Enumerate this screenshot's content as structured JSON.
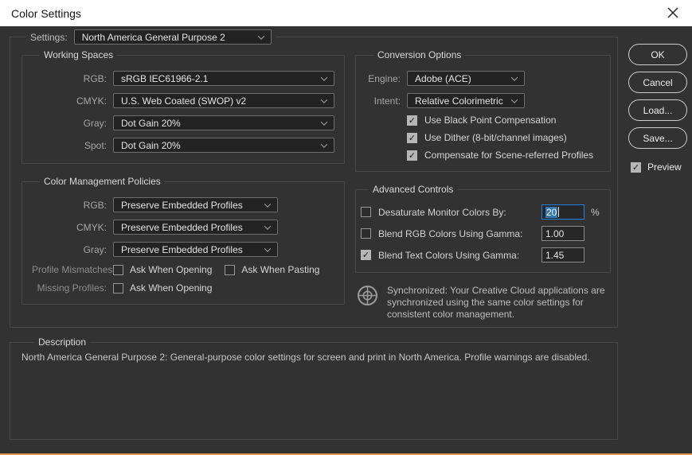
{
  "window": {
    "title": "Color Settings"
  },
  "settings": {
    "label": "Settings:",
    "value": "North America General Purpose 2"
  },
  "working_spaces": {
    "title": "Working Spaces",
    "rows": [
      {
        "label": "RGB:",
        "value": "sRGB IEC61966-2.1"
      },
      {
        "label": "CMYK:",
        "value": "U.S. Web Coated (SWOP) v2"
      },
      {
        "label": "Gray:",
        "value": "Dot Gain 20%"
      },
      {
        "label": "Spot:",
        "value": "Dot Gain 20%"
      }
    ]
  },
  "color_management_policies": {
    "title": "Color Management Policies",
    "rows": [
      {
        "label": "RGB:",
        "value": "Preserve Embedded Profiles"
      },
      {
        "label": "CMYK:",
        "value": "Preserve Embedded Profiles"
      },
      {
        "label": "Gray:",
        "value": "Preserve Embedded Profiles"
      }
    ],
    "profile_mismatches": {
      "label": "Profile Mismatches:",
      "options": [
        {
          "label": "Ask When Opening",
          "checked": false
        },
        {
          "label": "Ask When Pasting",
          "checked": false
        }
      ]
    },
    "missing_profiles": {
      "label": "Missing Profiles:",
      "options": [
        {
          "label": "Ask When Opening",
          "checked": false
        }
      ]
    }
  },
  "conversion_options": {
    "title": "Conversion Options",
    "engine": {
      "label": "Engine:",
      "value": "Adobe (ACE)"
    },
    "intent": {
      "label": "Intent:",
      "value": "Relative Colorimetric"
    },
    "checkboxes": [
      {
        "label": "Use Black Point Compensation",
        "checked": true
      },
      {
        "label": "Use Dither (8-bit/channel images)",
        "checked": true
      },
      {
        "label": "Compensate for Scene-referred Profiles",
        "checked": true
      }
    ]
  },
  "advanced_controls": {
    "title": "Advanced Controls",
    "rows": [
      {
        "label": "Desaturate Monitor Colors By:",
        "value": "20",
        "suffix": "%",
        "checked": false,
        "focused": true
      },
      {
        "label": "Blend RGB Colors Using Gamma:",
        "value": "1.00",
        "suffix": "",
        "checked": false
      },
      {
        "label": "Blend Text Colors Using Gamma:",
        "value": "1.45",
        "suffix": "",
        "checked": true
      }
    ]
  },
  "sync": {
    "icon": "creative-cloud-sync-icon",
    "text": "Synchronized: Your Creative Cloud applications are synchronized using the same color settings for consistent color management."
  },
  "buttons": {
    "ok": "OK",
    "cancel": "Cancel",
    "load": "Load...",
    "save": "Save..."
  },
  "preview": {
    "label": "Preview",
    "checked": true
  },
  "description": {
    "title": "Description",
    "text": "North America General Purpose 2:  General-purpose color settings for screen and print in North America. Profile warnings are disabled."
  },
  "colors": {
    "dialog_bg": "#323232",
    "titlebar_bg": "#ffffff",
    "focus_blue": "#1f82e0",
    "selection_blue": "#3677b5",
    "accent_orange": "#dd9a50"
  }
}
